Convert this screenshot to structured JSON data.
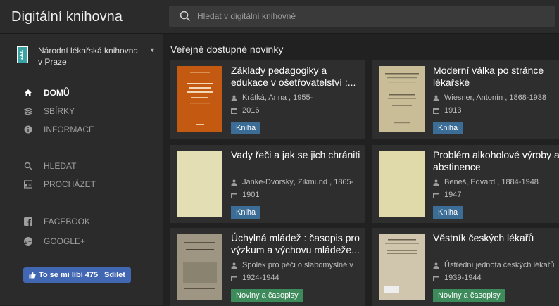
{
  "app": {
    "title": "Digitální knihovna"
  },
  "search": {
    "placeholder": "Hledat v digitální knihovně"
  },
  "sidebar": {
    "library_name": "Národní lékařská knihovna v Praze",
    "items": [
      {
        "label": "DOMŮ",
        "icon": "home-icon",
        "active": true
      },
      {
        "label": "SBÍRKY",
        "icon": "collections-icon",
        "active": false
      },
      {
        "label": "INFORMACE",
        "icon": "info-icon",
        "active": false
      },
      {
        "label": "HLEDAT",
        "icon": "search-icon",
        "active": false
      },
      {
        "label": "PROCHÁZET",
        "icon": "browse-icon",
        "active": false
      },
      {
        "label": "FACEBOOK",
        "icon": "facebook-icon",
        "active": false
      },
      {
        "label": "GOOGLE+",
        "icon": "google-plus-icon",
        "active": false
      }
    ],
    "fb_like_label": "To se mi líbí 475",
    "fb_share_label": "Sdílet"
  },
  "main": {
    "section_title": "Veřejně dostupné novinky",
    "cards": [
      {
        "title": "Základy pedagogiky a edukace v ošetřovatelství :...",
        "author": "Krátká, Anna , 1955-",
        "date": "2016",
        "badge": "Kniha",
        "badge_type": "book",
        "cover_color": "#c45a12"
      },
      {
        "title": "Moderní válka po stránce lékařské",
        "author": "Wiesner, Antonín , 1868-1938",
        "date": "1913",
        "badge": "Kniha",
        "badge_type": "book",
        "cover_color": "#c9bd97"
      },
      {
        "title": "Vady řeči a jak se jich chrániti",
        "author": "Janke-Dvorský, Zikmund , 1865-",
        "date": "1901",
        "badge": "Kniha",
        "badge_type": "book",
        "cover_color": "#e4deb5"
      },
      {
        "title": "Problém alkoholové výroby a abstinence",
        "author": "Beneš, Edvard , 1884-1948",
        "date": "1947",
        "badge": "Kniha",
        "badge_type": "book",
        "cover_color": "#e0d9a9"
      },
      {
        "title": "Úchylná mládež : časopis pro výzkum a výchovu mládeže...",
        "author": "Spolek pro péči o slabomyslné v",
        "date": "1924-1944",
        "badge": "Noviny a časopisy",
        "badge_type": "journal",
        "cover_color": "#9e9682"
      },
      {
        "title": "Věstník českých lékařů",
        "author": "Ústřední jednota českých lékařů",
        "date": "1939-1944",
        "badge": "Noviny a časopisy",
        "badge_type": "journal",
        "cover_color": "#cfc6ad"
      }
    ]
  }
}
